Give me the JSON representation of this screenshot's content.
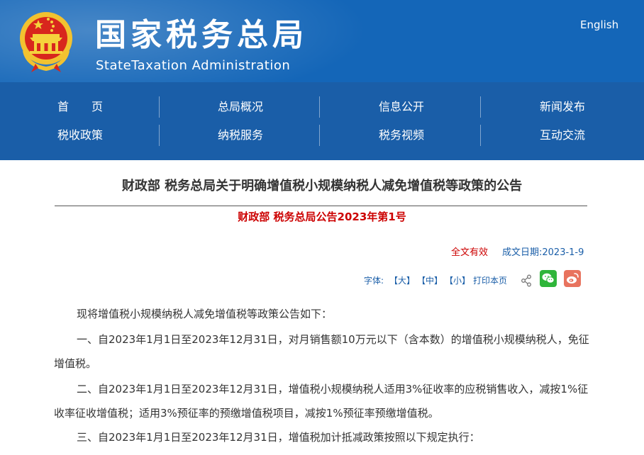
{
  "header": {
    "title_cn": "国家税务总局",
    "title_en": "StateTaxation Administration",
    "language_link": "English"
  },
  "nav": {
    "items": [
      {
        "label": "首　　页"
      },
      {
        "label": "总局概况"
      },
      {
        "label": "信息公开"
      },
      {
        "label": "新闻发布"
      },
      {
        "label": "税收政策"
      },
      {
        "label": "纳税服务"
      },
      {
        "label": "税务视频"
      },
      {
        "label": "互动交流"
      }
    ]
  },
  "article": {
    "title": "财政部 税务总局关于明确增值税小规模纳税人减免增值税等政策的公告",
    "doc_number": "财政部 税务总局公告2023年第1号",
    "validity": "全文有效",
    "date": "成文日期:2023-1-9",
    "font_size_label": "字体:",
    "font_large": "【大】",
    "font_medium": "【中】",
    "font_small": "【小】",
    "print": "打印本页",
    "paragraphs": [
      "现将增值税小规模纳税人减免增值税等政策公告如下：",
      "一、自2023年1月1日至2023年12月31日，对月销售额10万元以下（含本数）的增值税小规模纳税人，免征增值税。",
      "二、自2023年1月1日至2023年12月31日，增值税小规模纳税人适用3%征收率的应税销售收入，减按1%征收率征收增值税；适用3%预征率的预缴增值税项目，减按1%预征率预缴增值税。",
      "三、自2023年1月1日至2023年12月31日，增值税加计抵减政策按照以下规定执行："
    ]
  },
  "colors": {
    "header_blue": "#1466b8",
    "nav_blue": "#1a5ea8",
    "accent_red": "#cc0000",
    "wechat_green": "#2fb53a",
    "weibo_orange": "#e8735e"
  },
  "icons": [
    "national-emblem-icon",
    "share-icon",
    "wechat-icon",
    "weibo-icon"
  ]
}
